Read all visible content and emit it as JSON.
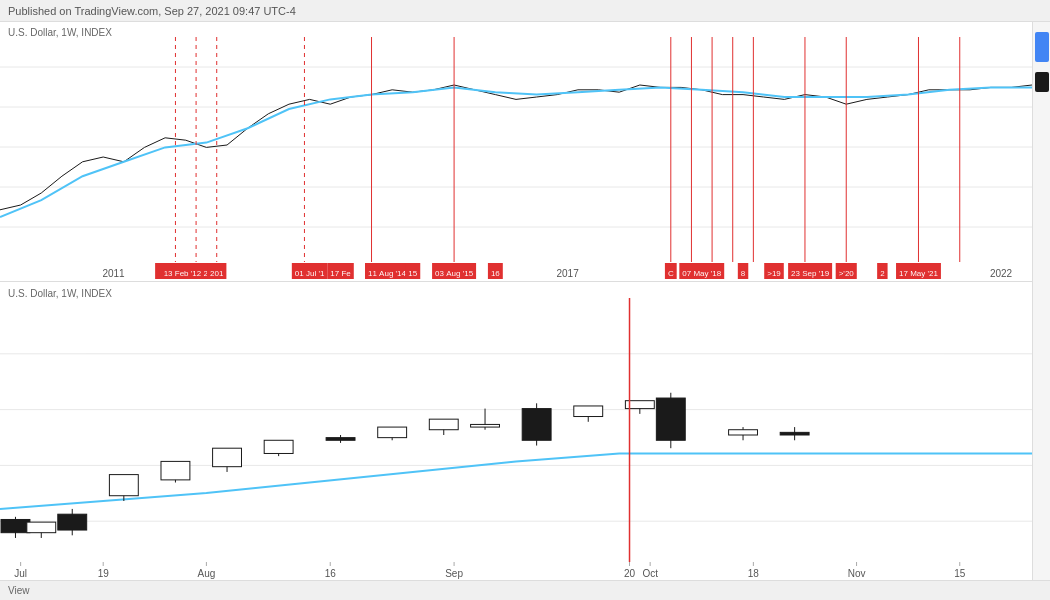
{
  "header": {
    "published_text": "Published on TradingView.com, Sep 27, 2021 09:47 UTC-4"
  },
  "top_chart": {
    "label": "U.S. Dollar, 1W, INDEX",
    "events": [
      {
        "label": "13 Feb '12 2",
        "x_pct": 17.5
      },
      {
        "label": "201",
        "x_pct": 22
      },
      {
        "label": "01 Jul '1",
        "x_pct": 29
      },
      {
        "label": "17 Fe",
        "x_pct": 33
      },
      {
        "label": "11 Aug '14",
        "x_pct": 37
      },
      {
        "label": "15",
        "x_pct": 40
      },
      {
        "label": "03 Aug '15",
        "x_pct": 44
      },
      {
        "label": "16",
        "x_pct": 48
      },
      {
        "label": "2017",
        "x_pct": 56
      },
      {
        "label": "C",
        "x_pct": 65
      },
      {
        "label": "07 May '18",
        "x_pct": 68
      },
      {
        "label": "8",
        "x_pct": 72
      },
      {
        "label": ">19",
        "x_pct": 75
      },
      {
        "label": "23 Sep '19",
        "x_pct": 78
      },
      {
        "label": ">'20",
        "x_pct": 82
      },
      {
        "label": "2",
        "x_pct": 85
      },
      {
        "label": "17 May '21",
        "x_pct": 89
      },
      {
        "label": "2022",
        "x_pct": 95
      }
    ],
    "year_labels": [
      "2011",
      "2017",
      "2022"
    ]
  },
  "bottom_chart": {
    "label": "U.S. Dollar, 1W, INDEX",
    "x_labels": [
      "Jul",
      "19",
      "Aug",
      "16",
      "Sep",
      "20",
      "Oct",
      "18",
      "Nov",
      "15"
    ],
    "red_line_x_pct": 61
  },
  "footer": {
    "text": "View"
  },
  "colors": {
    "red_line": "#e03030",
    "blue_line": "#4fc3f7",
    "candle_black": "#1a1a1a",
    "candle_white": "#ffffff",
    "candle_border": "#1a1a1a"
  }
}
